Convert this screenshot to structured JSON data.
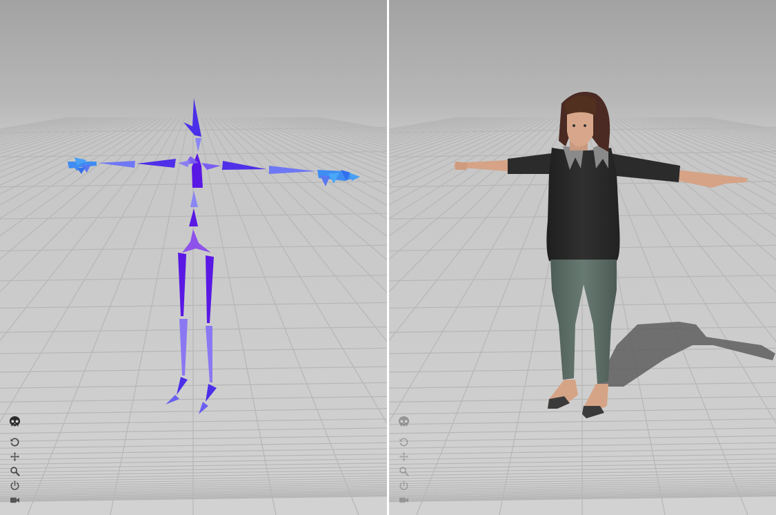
{
  "viewports": [
    {
      "name": "skeleton-view",
      "background": {
        "top": "#a3a3a3",
        "floor": "#cfcfcf",
        "grid": "#b6b6b6"
      },
      "bone_colors": {
        "dark": "#5a14e0",
        "mid": "#6a4cf0",
        "light": "#7a86f6",
        "hands": "#3a8cf2"
      },
      "toolbar": [
        "skeleton-icon",
        "reset-icon",
        "move-icon",
        "zoom-icon",
        "power-icon",
        "camera-icon"
      ],
      "toolbar_state": "active"
    },
    {
      "name": "model-view",
      "background": {
        "top": "#a3a3a3",
        "floor": "#cfcfcf",
        "grid": "#b6b6b6"
      },
      "model_colors": {
        "skin": "#d9a98b",
        "hair": "#4a2a22",
        "top": "#2a2a2a",
        "jeans": "#5a6b64",
        "shoes": "#3a3a3a"
      },
      "toolbar": [
        "skeleton-icon",
        "reset-icon",
        "move-icon",
        "zoom-icon",
        "power-icon",
        "camera-icon"
      ],
      "toolbar_state": "disabled"
    }
  ]
}
